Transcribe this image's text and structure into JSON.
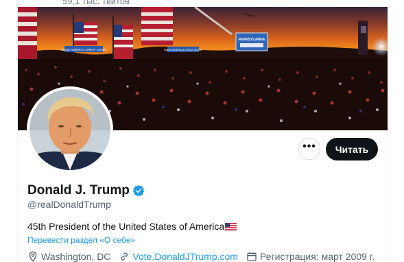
{
  "header": {
    "tweet_count": "59,1 тыс. твитов"
  },
  "banner": {
    "signs": [
      "MAKE AMERICA GREAT AGAIN",
      "MAKE AMERICA GREAT AGAIN",
      "PENNSYLVANIA"
    ],
    "colors": {
      "sky_top": "#3a2138",
      "sunset": "#f08a1c",
      "crowd": "#1a0b09",
      "sign": "#2a5aa8"
    }
  },
  "profile": {
    "display_name": "Donald J. Trump",
    "handle": "@realDonaldTrump",
    "verified_color": "#1d9bf0",
    "bio": "45th President of the United States of America",
    "translate_label": "Перевести раздел «О себе»",
    "location": "Washington, DC",
    "website": "Vote.DonaldJTrump.com",
    "joined": "Регистрация: март 2009 г."
  },
  "actions": {
    "more_label": "•••",
    "follow_label": "Читать"
  }
}
